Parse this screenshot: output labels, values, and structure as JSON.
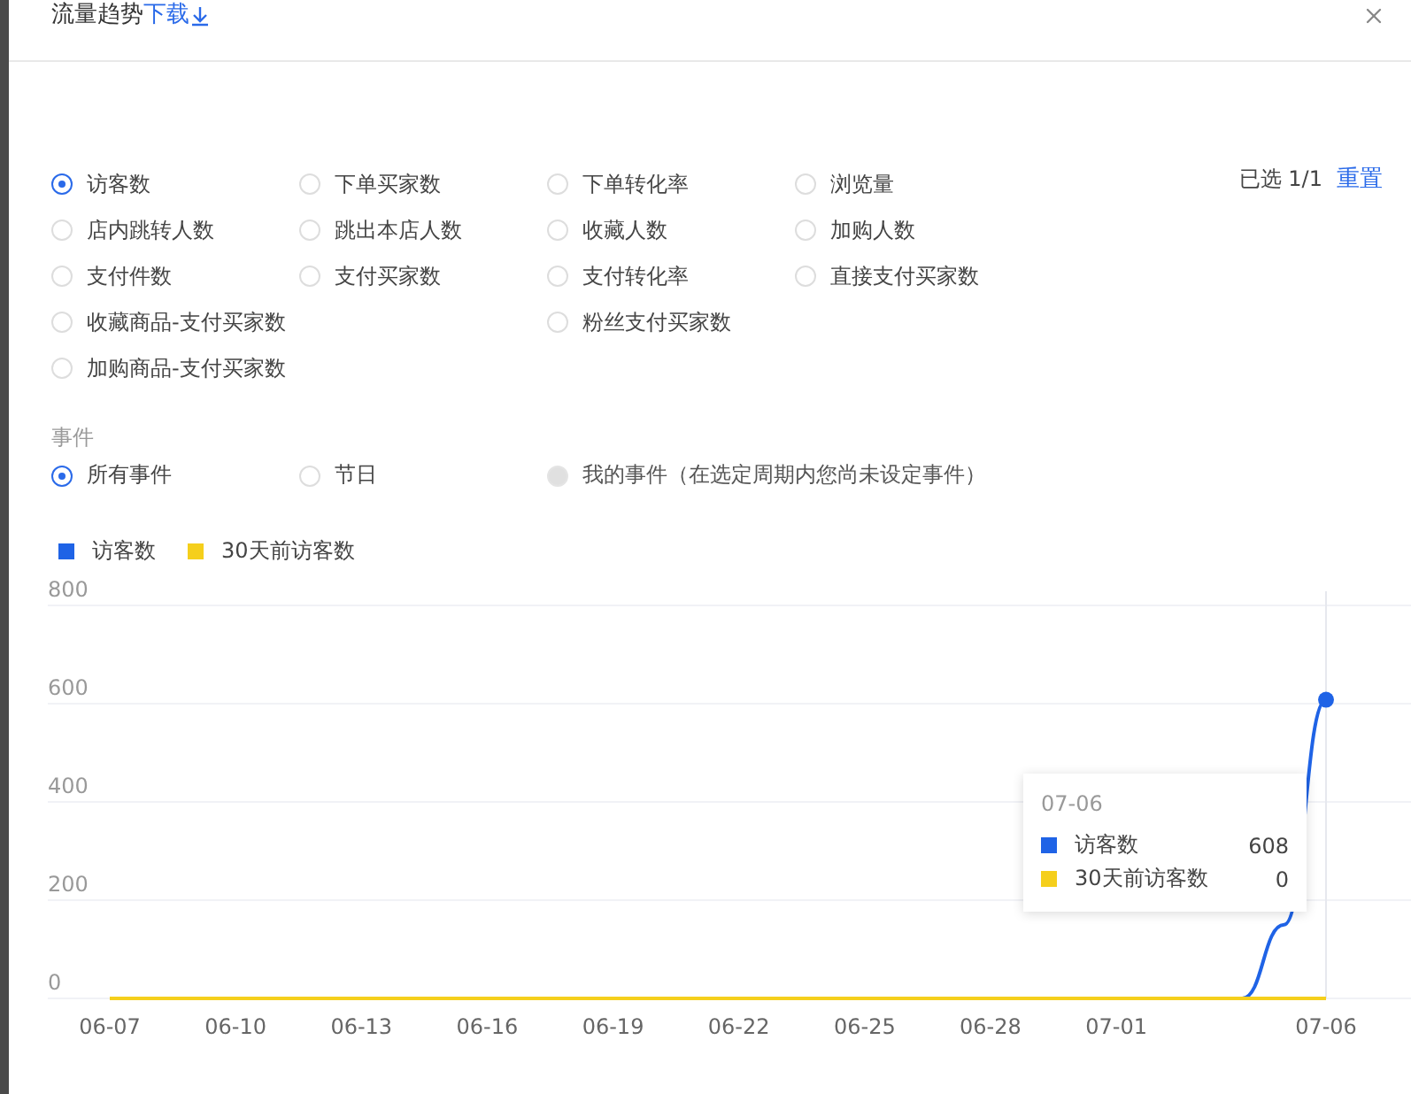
{
  "dialog": {
    "title": "流量趋势",
    "download_link": "下载"
  },
  "metrics": {
    "selected_count": "已选 1/1",
    "reset": "重置",
    "items": [
      {
        "label": "访客数",
        "selected": true,
        "wide": false
      },
      {
        "label": "下单买家数",
        "selected": false,
        "wide": false
      },
      {
        "label": "下单转化率",
        "selected": false,
        "wide": false
      },
      {
        "label": "浏览量",
        "selected": false,
        "wide": false
      },
      {
        "label": "店内跳转人数",
        "selected": false,
        "wide": false
      },
      {
        "label": "跳出本店人数",
        "selected": false,
        "wide": false
      },
      {
        "label": "收藏人数",
        "selected": false,
        "wide": false
      },
      {
        "label": "加购人数",
        "selected": false,
        "wide": false
      },
      {
        "label": "支付件数",
        "selected": false,
        "wide": false
      },
      {
        "label": "支付买家数",
        "selected": false,
        "wide": false
      },
      {
        "label": "支付转化率",
        "selected": false,
        "wide": false
      },
      {
        "label": "直接支付买家数",
        "selected": false,
        "wide": false
      },
      {
        "label": "收藏商品-支付买家数",
        "selected": false,
        "wide": true
      },
      {
        "label": "粉丝支付买家数",
        "selected": false,
        "wide": false
      },
      {
        "label": "加购商品-支付买家数",
        "selected": false,
        "wide": true
      }
    ]
  },
  "events": {
    "label": "事件",
    "options": [
      {
        "label": "所有事件",
        "selected": true,
        "disabled": false
      },
      {
        "label": "节日",
        "selected": false,
        "disabled": false
      },
      {
        "label": "我的事件（在选定周期内您尚未设定事件）",
        "selected": false,
        "disabled": true
      }
    ]
  },
  "chart": {
    "tooltip": {
      "date": "07-06",
      "rows": [
        {
          "label": "访客数",
          "value": "608",
          "color": "#1f63e6"
        },
        {
          "label": "30天前访客数",
          "value": "0",
          "color": "#f5cf1c"
        }
      ]
    },
    "chart_data": {
      "type": "line",
      "legend": "top-left",
      "grid": true,
      "categories": [
        "06-07",
        null,
        null,
        "06-10",
        null,
        null,
        "06-13",
        null,
        null,
        "06-16",
        null,
        null,
        "06-19",
        null,
        null,
        "06-22",
        null,
        null,
        "06-25",
        null,
        null,
        "06-28",
        null,
        null,
        "07-01",
        null,
        null,
        null,
        null,
        "07-06"
      ],
      "series": [
        {
          "name": "访客数",
          "color": "#1f63e6",
          "values": [
            null,
            null,
            null,
            null,
            null,
            null,
            null,
            null,
            null,
            null,
            null,
            null,
            null,
            null,
            null,
            null,
            null,
            null,
            null,
            null,
            null,
            null,
            null,
            null,
            null,
            null,
            null,
            0,
            150,
            608
          ]
        },
        {
          "name": "30天前访客数",
          "color": "#f5cf1c",
          "values": [
            0,
            0,
            0,
            0,
            0,
            0,
            0,
            0,
            0,
            0,
            0,
            0,
            0,
            0,
            0,
            0,
            0,
            0,
            0,
            0,
            0,
            0,
            0,
            0,
            0,
            0,
            0,
            0,
            0,
            0
          ]
        }
      ],
      "ylim": [
        0,
        800
      ],
      "yticks": [
        0,
        200,
        400,
        600,
        800
      ]
    }
  }
}
